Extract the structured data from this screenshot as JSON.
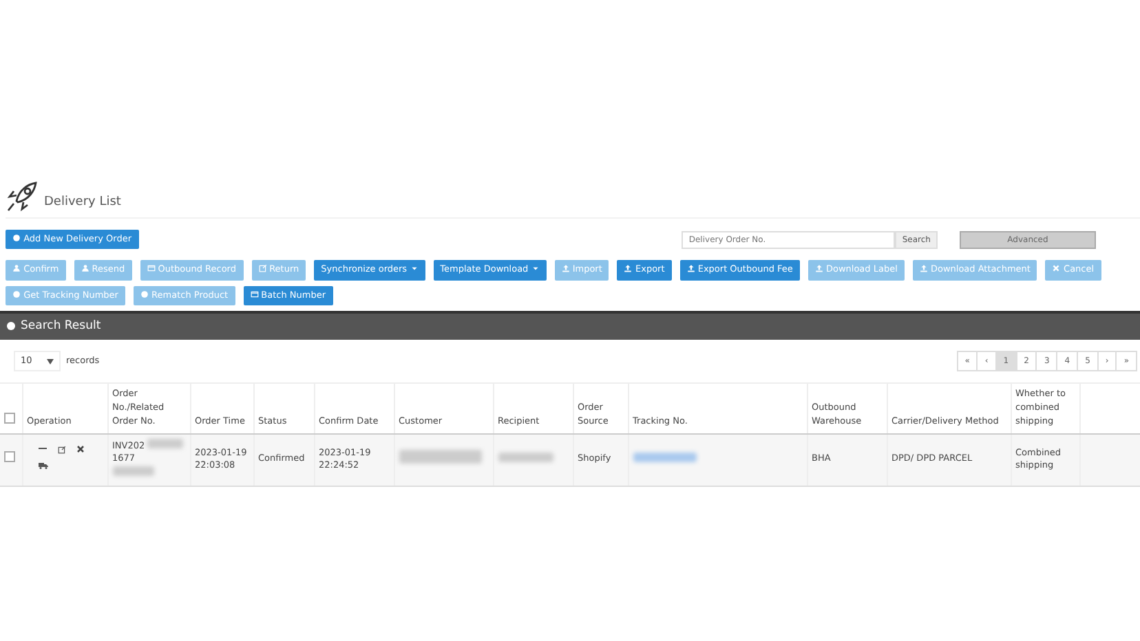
{
  "page_title": "Delivery List",
  "add_button": "Add New Delivery Order",
  "search": {
    "placeholder": "Delivery Order No.",
    "button": "Search",
    "advanced": "Advanced"
  },
  "actions": [
    {
      "label": "Confirm",
      "kind": "user",
      "disabled": true
    },
    {
      "label": "Resend",
      "kind": "user",
      "disabled": true
    },
    {
      "label": "Outbound Record",
      "kind": "card",
      "disabled": true
    },
    {
      "label": "Return",
      "kind": "edit",
      "disabled": true
    },
    {
      "label": "Synchronize orders",
      "kind": "caret",
      "disabled": false
    },
    {
      "label": "Template Download",
      "kind": "caret",
      "disabled": false
    },
    {
      "label": "Import",
      "kind": "upload",
      "disabled": true
    },
    {
      "label": "Export",
      "kind": "upload",
      "disabled": false
    },
    {
      "label": "Export Outbound Fee",
      "kind": "upload",
      "disabled": false
    },
    {
      "label": "Download Label",
      "kind": "upload",
      "disabled": true
    },
    {
      "label": "Download Attachment",
      "kind": "upload",
      "disabled": true
    },
    {
      "label": "Cancel",
      "kind": "times",
      "disabled": true
    },
    {
      "label": "Get Tracking Number",
      "kind": "circle",
      "disabled": true
    },
    {
      "label": "Rematch Product",
      "kind": "circle",
      "disabled": true
    },
    {
      "label": "Batch Number",
      "kind": "card",
      "disabled": false
    }
  ],
  "panel_title": "Search Result",
  "page_size": {
    "value": "10",
    "label": "records"
  },
  "pagination": [
    {
      "label": "«",
      "selected": false
    },
    {
      "label": "‹",
      "selected": false
    },
    {
      "label": "1",
      "selected": true
    },
    {
      "label": "2",
      "selected": false
    },
    {
      "label": "3",
      "selected": false
    },
    {
      "label": "4",
      "selected": false
    },
    {
      "label": "5",
      "selected": false
    },
    {
      "label": "›",
      "selected": false
    },
    {
      "label": "»",
      "selected": false
    }
  ],
  "table": {
    "select_all": false,
    "columns": [
      "Operation",
      "Order No./Related Order No.",
      "Order Time",
      "Status",
      "Confirm Date",
      "Customer",
      "Recipient",
      "Order Source",
      "Tracking No.",
      "Outbound Warehouse",
      "Carrier/Delivery Method",
      "Whether to combined shipping"
    ],
    "rows": [
      {
        "checked": false,
        "order_no": "INV202",
        "order_no_2": "1677",
        "order_time": "2023-01-19 22:03:08",
        "status": "Confirmed",
        "confirm_date": "2023-01-19 22:24:52",
        "order_source": "Shopify",
        "warehouse": "BHA",
        "carrier": "DPD/ DPD PARCEL",
        "combined": "Combined shipping"
      }
    ]
  }
}
